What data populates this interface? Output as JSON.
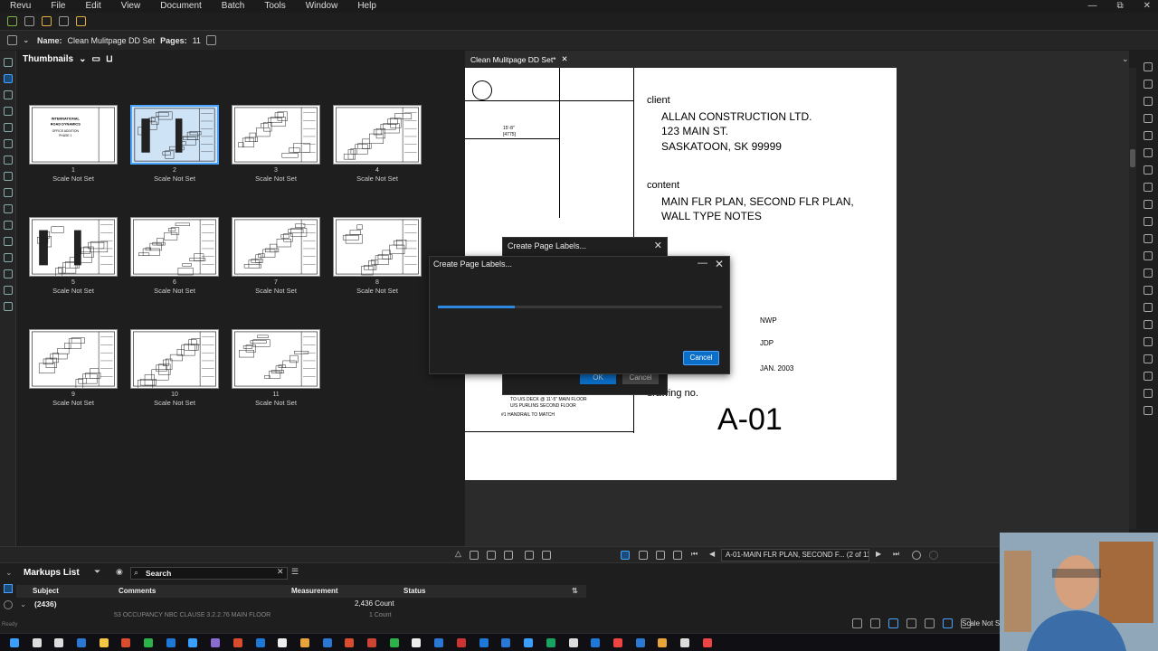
{
  "menu": [
    "Revu",
    "File",
    "Edit",
    "View",
    "Document",
    "Batch",
    "Tools",
    "Window",
    "Help"
  ],
  "window_controls": [
    "—",
    "⧉",
    "✕"
  ],
  "docbar": {
    "name_label": "Name:",
    "name_value": "Clean Mulitpage DD Set",
    "pages_label": "Pages:",
    "pages_value": "11"
  },
  "thumbnails": {
    "title": "Thumbnails",
    "items": [
      {
        "num": "1",
        "scale": "Scale Not Set"
      },
      {
        "num": "2",
        "scale": "Scale Not Set"
      },
      {
        "num": "3",
        "scale": "Scale Not Set"
      },
      {
        "num": "4",
        "scale": "Scale Not Set"
      },
      {
        "num": "5",
        "scale": "Scale Not Set"
      },
      {
        "num": "6",
        "scale": "Scale Not Set"
      },
      {
        "num": "7",
        "scale": "Scale Not Set"
      },
      {
        "num": "8",
        "scale": "Scale Not Set"
      },
      {
        "num": "9",
        "scale": "Scale Not Set"
      },
      {
        "num": "10",
        "scale": "Scale Not Set"
      },
      {
        "num": "11",
        "scale": "Scale Not Set"
      }
    ],
    "selected": "2",
    "cover_text": [
      "INTERNATIONAL",
      "ROAD DYNAMICS",
      "OFFICE ADDITION",
      "PHASE 1"
    ]
  },
  "document_tab": {
    "label": "Clean Mulitpage DD Set*",
    "close": "✕"
  },
  "drawing": {
    "client_label": "client",
    "client_lines": [
      "ALLAN CONSTRUCTION LTD.",
      "123 MAIN ST.",
      "SASKATOON,  SK  99999"
    ],
    "content_label": "content",
    "content_lines": [
      "MAIN FLR PLAN, SECOND FLR PLAN,",
      "WALL TYPE NOTES"
    ],
    "drawn_by": "NWP",
    "checked_by": "JDP",
    "date": "JAN.  2003",
    "drawing_no_label": "drawing no.",
    "drawing_no": "A-01",
    "dim_text": "15'-8\"",
    "dim_text2": "[4775]",
    "note_lines": [
      "TO U/S DECK @ 11'-5\" MAIN FLOOR",
      "U/S PURLINS SECOND FLOOR",
      "#1  HANDRAIL TO MATCH"
    ]
  },
  "dialog_back": {
    "title": "Create Page Labels...",
    "ok": "OK",
    "cancel": "Cancel"
  },
  "dialog_front": {
    "title": "Create Page Labels...",
    "progress": 0.27,
    "cancel": "Cancel",
    "close": "✕",
    "minimize": "—"
  },
  "navbar": {
    "page_label": "A-01-MAIN FLR PLAN, SECOND F... (2 of 11)"
  },
  "markups": {
    "title": "Markups List",
    "search_placeholder": "Search",
    "columns": [
      "Subject",
      "Comments",
      "Measurement",
      "Status"
    ],
    "row": {
      "subject": "(2436)",
      "measurement": "2,436 Count"
    },
    "row2": {
      "comment": "53 OCCUPANCY NBC CLAUSE 3.2.2.76 MAIN FLOOR",
      "measurement": "1 Count"
    }
  },
  "status_bar": {
    "ready": "Ready",
    "scale": "Scale Not S"
  },
  "colors": {
    "accent": "#2f88e0",
    "selected_thumb": "#4aa3ff",
    "bg": "#1e1e1e"
  }
}
